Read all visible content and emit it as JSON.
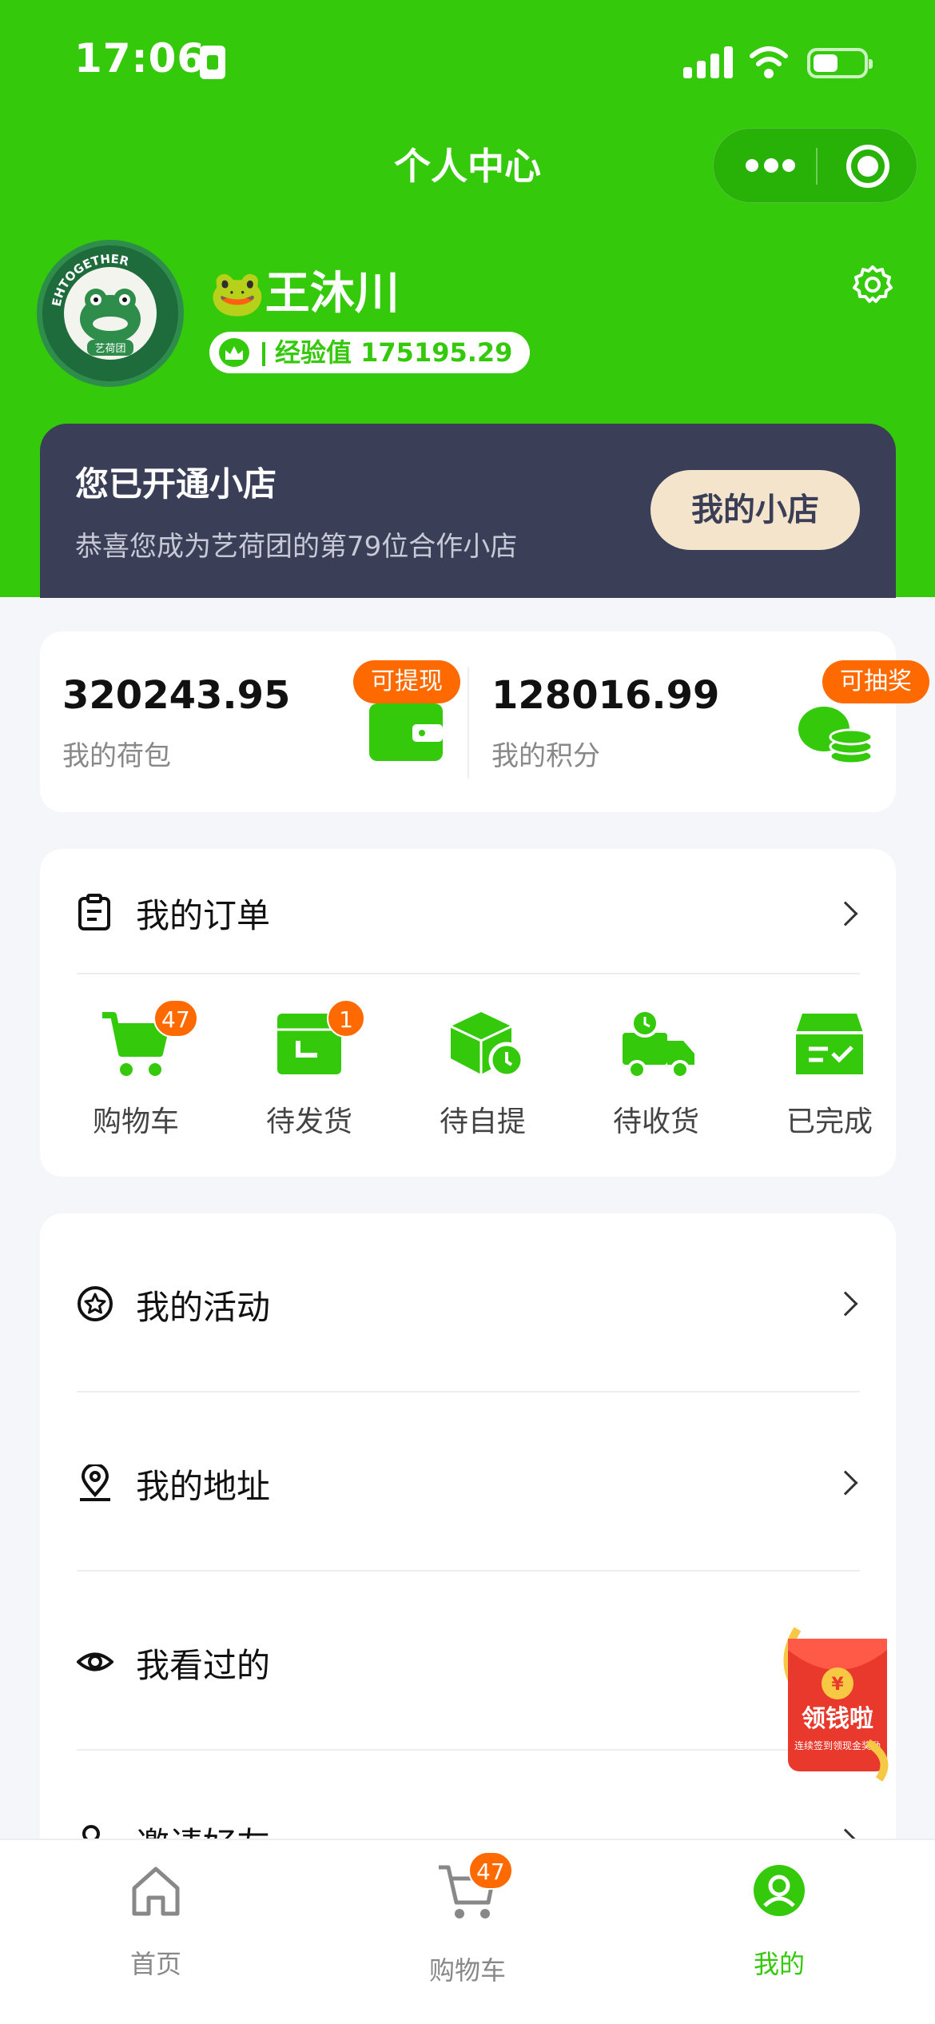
{
  "status": {
    "time": "17:06"
  },
  "title": "个人中心",
  "profile": {
    "nickname": "🐸王沐川",
    "exp_label": "经验值 175195.29",
    "avatar_text": "EHTOGETHER",
    "avatar_sub": "艺荷团"
  },
  "shop": {
    "title": "您已开通小店",
    "subtitle": "恭喜您成为艺荷团的第79位合作小店",
    "button": "我的小店"
  },
  "wallet": {
    "balance": "320243.95",
    "balance_label": "我的荷包",
    "balance_tag": "可提现",
    "points": "128016.99",
    "points_label": "我的积分",
    "points_tag": "可抽奖"
  },
  "orders": {
    "title": "我的订单",
    "items": [
      {
        "label": "购物车",
        "badge": "47"
      },
      {
        "label": "待发货",
        "badge": "1"
      },
      {
        "label": "待自提",
        "badge": ""
      },
      {
        "label": "待收货",
        "badge": ""
      },
      {
        "label": "已完成",
        "badge": ""
      }
    ]
  },
  "menu": {
    "items": [
      {
        "label": "我的活动",
        "icon": "star-circle-icon"
      },
      {
        "label": "我的地址",
        "icon": "location-icon"
      },
      {
        "label": "我看过的",
        "icon": "eye-icon"
      },
      {
        "label": "邀请好友",
        "icon": "invite-icon"
      }
    ]
  },
  "promo": {
    "label": "领钱啦",
    "sub": "连续签到领现金奖励"
  },
  "tabbar": {
    "items": [
      {
        "label": "首页"
      },
      {
        "label": "购物车",
        "badge": "47"
      },
      {
        "label": "我的"
      }
    ]
  },
  "colors": {
    "brand": "#34c90a",
    "accent": "#ff6a00",
    "shop_bg": "#3a3e56"
  }
}
